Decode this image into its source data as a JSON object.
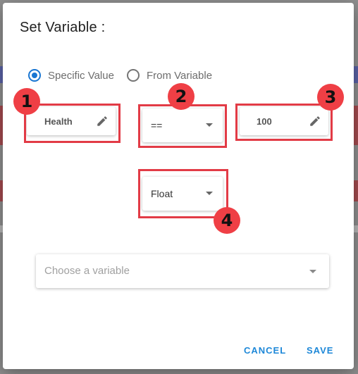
{
  "dialog": {
    "title": "Set Variable :"
  },
  "value_source": {
    "options": [
      {
        "label": "Specific Value",
        "checked": true
      },
      {
        "label": "From Variable",
        "checked": false
      }
    ]
  },
  "condition": {
    "variable_name": "Health",
    "operator": "==",
    "value": "100",
    "type": "Float"
  },
  "callouts": [
    "1",
    "2",
    "3",
    "4"
  ],
  "variable_select": {
    "placeholder": "Choose a variable"
  },
  "actions": {
    "cancel": "CANCEL",
    "save": "SAVE"
  },
  "colors": {
    "accent": "#1976d2",
    "highlight": "#e23b46"
  },
  "icons": [
    "pencil-icon",
    "chevron-down-icon"
  ]
}
